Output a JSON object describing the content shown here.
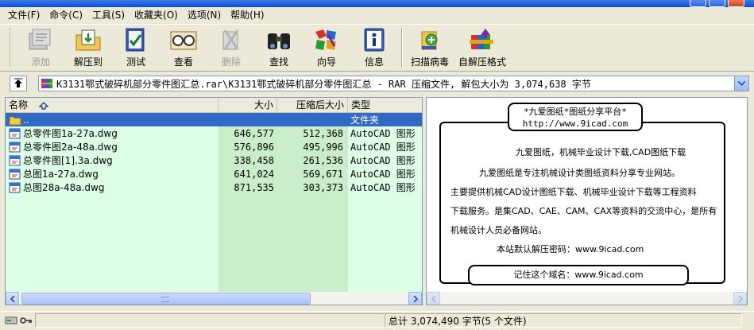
{
  "menubar": {
    "items": [
      "文件(F)",
      "命令(C)",
      "工具(S)",
      "收藏夹(O)",
      "选项(N)",
      "帮助(H)"
    ]
  },
  "toolbar": {
    "items": [
      {
        "label": "添加",
        "icon": "add-icon",
        "disabled": true
      },
      {
        "label": "解压到",
        "icon": "extract-to-icon",
        "disabled": false
      },
      {
        "label": "测试",
        "icon": "test-icon",
        "disabled": false
      },
      {
        "label": "查看",
        "icon": "view-icon",
        "disabled": false
      },
      {
        "label": "删除",
        "icon": "delete-icon",
        "disabled": true
      },
      {
        "label": "查找",
        "icon": "find-icon",
        "disabled": false
      },
      {
        "label": "向导",
        "icon": "wizard-icon",
        "disabled": false
      },
      {
        "label": "信息",
        "icon": "info-icon",
        "disabled": false
      },
      {
        "label": "扫描病毒",
        "icon": "virus-scan-icon",
        "disabled": false
      },
      {
        "label": "自解压格式",
        "icon": "sfx-icon",
        "disabled": false
      }
    ]
  },
  "address": {
    "path": "K3131鄂式破碎机部分零件图汇总.rar\\K3131鄂式破碎机部分零件图汇总 - RAR 压缩文件, 解包大小为 3,074,638 字节"
  },
  "file_list": {
    "columns": {
      "name": "名称",
      "size": "大小",
      "packed": "压缩后大小",
      "type": "类型"
    },
    "rows": [
      {
        "name": "..",
        "size": "",
        "packed": "",
        "type": "文件夹",
        "folder": true,
        "selected": true
      },
      {
        "name": "总零件图1a-27a.dwg",
        "size": "646,577",
        "packed": "512,368",
        "type": "AutoCAD 图形",
        "folder": false,
        "selected": false
      },
      {
        "name": "总零件图2a-48a.dwg",
        "size": "576,896",
        "packed": "495,996",
        "type": "AutoCAD 图形",
        "folder": false,
        "selected": false
      },
      {
        "name": "总零件图[1].3a.dwg",
        "size": "338,458",
        "packed": "261,536",
        "type": "AutoCAD 图形",
        "folder": false,
        "selected": false
      },
      {
        "name": "总图1a-27a.dwg",
        "size": "641,024",
        "packed": "569,671",
        "type": "AutoCAD 图形",
        "folder": false,
        "selected": false
      },
      {
        "name": "总图28a-48a.dwg",
        "size": "871,535",
        "packed": "303,373",
        "type": "AutoCAD 图形",
        "folder": false,
        "selected": false
      }
    ]
  },
  "comment": {
    "title": "*九爱图纸*图纸分享平台*",
    "url": "http://www.9icad.com",
    "lines": [
      "九爱图纸，机械毕业设计下载,CAD图纸下载",
      "九爱图纸是专注机械设计类图纸资料分享专业网站。",
      "主要提供机械CAD设计图纸下载、机械毕业设计下载等工程资料",
      "下载服务。是集CAD、CAE、CAM、CAX等资料的交流中心，是所有",
      "机械设计人员必备网站。",
      "本站默认解压密码：www.9icad.com"
    ],
    "footer": "记住这个域名：www.9icad.com"
  },
  "status": {
    "left": "",
    "right": "总计 3,074,490 字节(5 个文件)"
  },
  "colors": {
    "selection": "#316ac5",
    "row_bg": "#dcffe6",
    "size_col_bg": "#c9eec9",
    "titlebar": "#0a4fd6"
  }
}
